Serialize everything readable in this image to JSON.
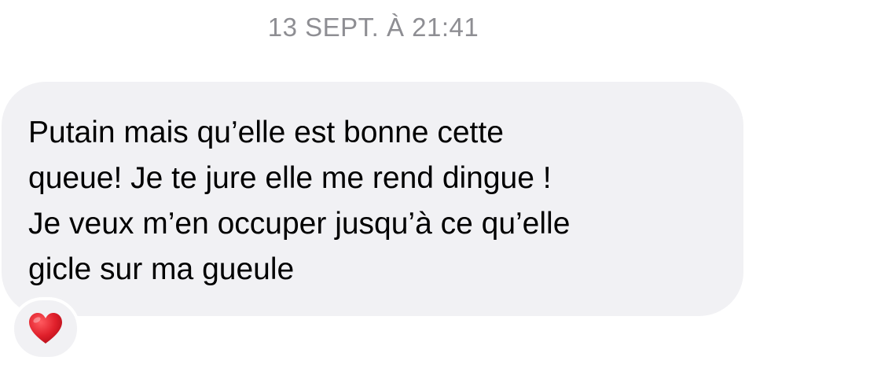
{
  "conversation": {
    "timestamp": "13 SEPT. À 21:41",
    "messages": [
      {
        "text": "Putain mais qu’elle est bonne cette\nqueue! Je te jure elle me rend dingue !\nJe veux m’en occuper jusqu’à ce qu’elle\ngicle sur ma gueule",
        "reaction": {
          "icon": "red-heart-icon",
          "color": "#e0202b"
        }
      }
    ]
  },
  "colors": {
    "bubble_background": "#f1f1f4",
    "timestamp_text": "#8e8e93",
    "message_text": "#000000"
  }
}
